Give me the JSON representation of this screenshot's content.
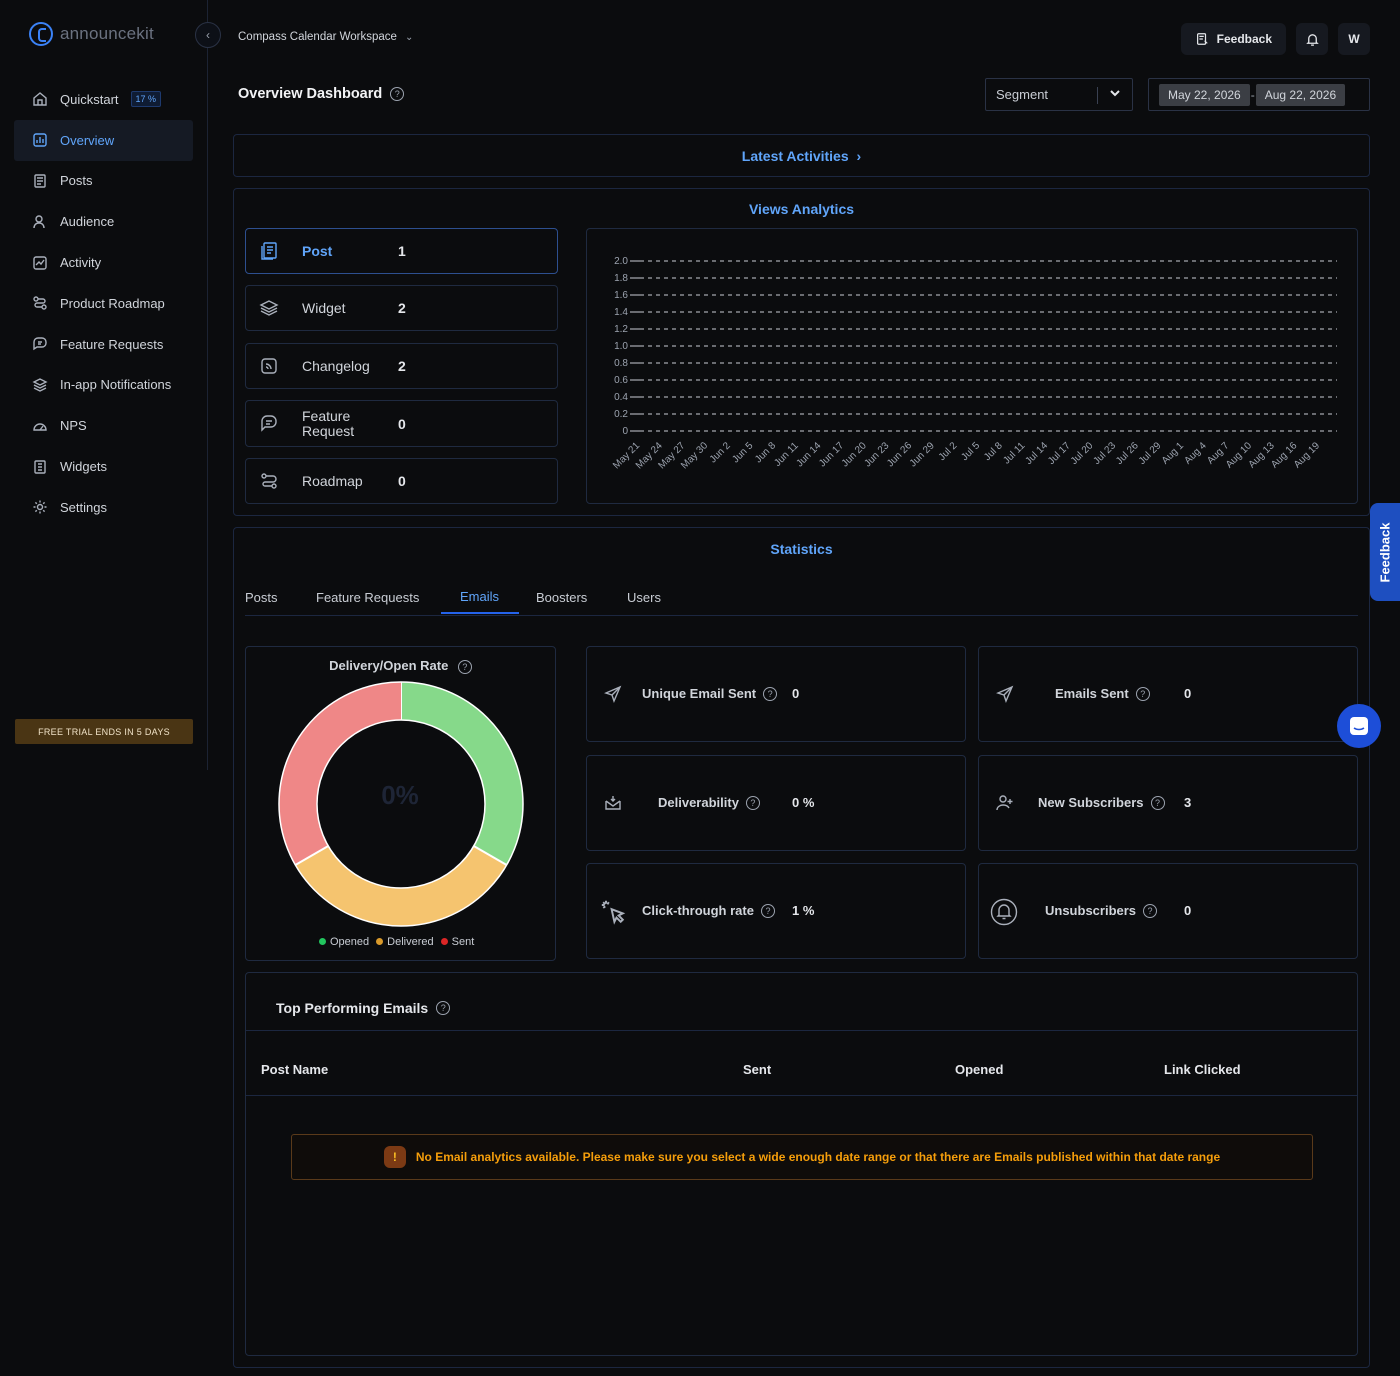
{
  "app": {
    "logo_text": "announcekit",
    "workspace": "Compass Calendar Workspace"
  },
  "header": {
    "feedback_label": "Feedback",
    "avatar_initial": "W"
  },
  "sidebar": {
    "items": [
      {
        "label": "Quickstart",
        "icon": "home-icon",
        "badge": "17 %"
      },
      {
        "label": "Overview",
        "icon": "chart-icon",
        "active": true
      },
      {
        "label": "Posts",
        "icon": "posts-icon"
      },
      {
        "label": "Audience",
        "icon": "users-icon"
      },
      {
        "label": "Activity",
        "icon": "activity-icon"
      },
      {
        "label": "Product Roadmap",
        "icon": "roadmap-icon"
      },
      {
        "label": "Feature Requests",
        "icon": "feature-icon"
      },
      {
        "label": "In-app Notifications",
        "icon": "layers-icon"
      },
      {
        "label": "NPS",
        "icon": "gauge-icon"
      },
      {
        "label": "Widgets",
        "icon": "widget-icon"
      },
      {
        "label": "Settings",
        "icon": "gear-icon"
      }
    ],
    "trial_text": "FREE TRIAL ENDS IN 5 DAYS"
  },
  "page": {
    "title": "Overview Dashboard"
  },
  "filters": {
    "segment_placeholder": "Segment",
    "date_start": "May 22, 2026",
    "date_end": "Aug 22, 2026"
  },
  "latest_activities": {
    "label": "Latest Activities"
  },
  "views_analytics": {
    "title": "Views Analytics",
    "items": [
      {
        "label": "Post",
        "count": "1",
        "icon": "post-icon",
        "active": true
      },
      {
        "label": "Widget",
        "count": "2",
        "icon": "layers-icon"
      },
      {
        "label": "Changelog",
        "count": "2",
        "icon": "changelog-icon"
      },
      {
        "label": "Feature Request",
        "count": "0",
        "icon": "feature-icon"
      },
      {
        "label": "Roadmap",
        "count": "0",
        "icon": "roadmap-icon"
      }
    ]
  },
  "chart_data": {
    "type": "line",
    "title": "",
    "xlabel": "",
    "ylabel": "",
    "ylim": [
      0,
      2.0
    ],
    "yticks": [
      "2.0",
      "1.8",
      "1.6",
      "1.4",
      "1.2",
      "1.0",
      "0.8",
      "0.6",
      "0.4",
      "0.2",
      "0"
    ],
    "categories": [
      "May 21",
      "May 24",
      "May 27",
      "May 30",
      "Jun 2",
      "Jun 5",
      "Jun 8",
      "Jun 11",
      "Jun 14",
      "Jun 17",
      "Jun 20",
      "Jun 23",
      "Jun 26",
      "Jun 29",
      "Jul 2",
      "Jul 5",
      "Jul 8",
      "Jul 11",
      "Jul 14",
      "Jul 17",
      "Jul 20",
      "Jul 23",
      "Jul 26",
      "Jul 29",
      "Aug 1",
      "Aug 4",
      "Aug 7",
      "Aug 10",
      "Aug 13",
      "Aug 16",
      "Aug 19"
    ],
    "series": [],
    "grid": true
  },
  "statistics": {
    "title": "Statistics",
    "tabs": [
      "Posts",
      "Feature Requests",
      "Emails",
      "Boosters",
      "Users"
    ],
    "active_tab": "Emails",
    "donut": {
      "title": "Delivery/Open Rate",
      "center": "0%",
      "segments": [
        {
          "name": "Opened",
          "value": 1,
          "color": "#86d98a"
        },
        {
          "name": "Delivered",
          "value": 1,
          "color": "#f5c46f"
        },
        {
          "name": "Sent",
          "value": 1,
          "color": "#ef8787"
        }
      ],
      "legend": [
        "Opened",
        "Delivered",
        "Sent"
      ],
      "legend_colors": [
        "#22c55e",
        "#d99a2b",
        "#dc2626"
      ]
    },
    "cards": [
      {
        "label": "Unique Email Sent",
        "value": "0",
        "icon": "send-icon"
      },
      {
        "label": "Emails Sent",
        "value": "0",
        "icon": "send-icon"
      },
      {
        "label": "Deliverability",
        "value": "0 %",
        "icon": "inbox-icon"
      },
      {
        "label": "New Subscribers",
        "value": "3",
        "icon": "user-plus-icon"
      },
      {
        "label": "Click-through rate",
        "value": "1 %",
        "icon": "cursor-click-icon"
      },
      {
        "label": "Unsubscribers",
        "value": "0",
        "icon": "bell-icon"
      }
    ]
  },
  "top_emails": {
    "title": "Top Performing Emails",
    "columns": [
      "Post Name",
      "Sent",
      "Opened",
      "Link Clicked"
    ],
    "empty_message": "No Email analytics available. Please make sure you select a wide enough date range or that there are Emails published within that date range"
  },
  "side_feedback_label": "Feedback"
}
